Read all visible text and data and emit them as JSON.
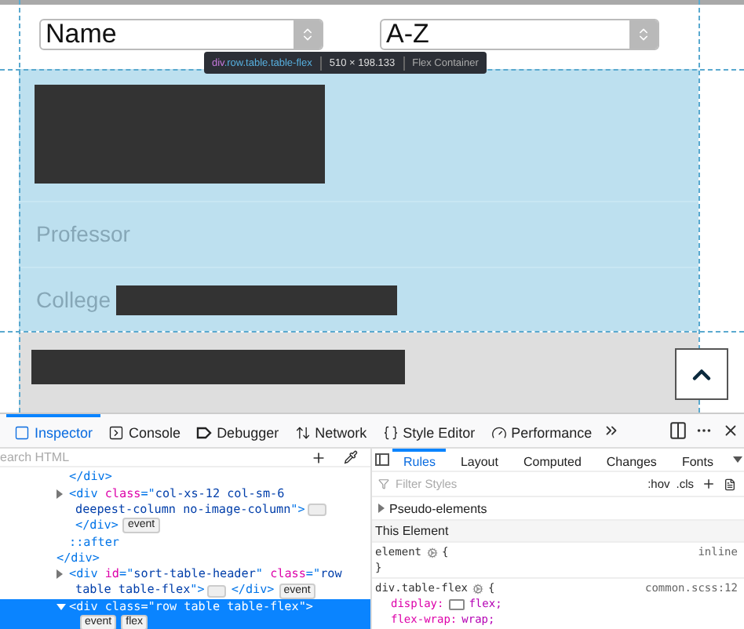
{
  "page": {
    "sort_selects": [
      {
        "value": "Name"
      },
      {
        "value": "A-Z"
      }
    ],
    "highlight_tooltip": {
      "tag": "div",
      "classes": ".row.table.table-flex",
      "size": "510 × 198.133",
      "kind_label": "Flex Container"
    },
    "card": {
      "role_label": "Professor",
      "college_label": "College"
    }
  },
  "devtools": {
    "tabs": [
      {
        "label": "Inspector",
        "selected": true
      },
      {
        "label": "Console",
        "selected": false
      },
      {
        "label": "Debugger",
        "selected": false
      },
      {
        "label": "Network",
        "selected": false
      },
      {
        "label": "Style Editor",
        "selected": false
      },
      {
        "label": "Performance",
        "selected": false
      }
    ],
    "search": {
      "placeholder": "earch HTML"
    },
    "markup": [
      {
        "selected": false,
        "children": [
          {
            "selected": false,
            "rows": [
              {
                "parts": [
                  {
                    "kind": "tag",
                    "text": "</div>"
                  }
                ]
              }
            ]
          },
          {
            "selected": false,
            "expanded": false,
            "rows": [
              {
                "parts": [
                  {
                    "kind": "tag",
                    "text": "<div "
                  },
                  {
                    "kind": "attr",
                    "text": "class"
                  },
                  {
                    "kind": "punct",
                    "text": "=\""
                  },
                  {
                    "kind": "value",
                    "text": "col-xs-12 col-sm-6"
                  }
                ]
              },
              {
                "parts": [
                  {
                    "kind": "value",
                    "text": "deepest-column no-image-column"
                  },
                  {
                    "kind": "punct",
                    "text": "\""
                  },
                  {
                    "kind": "tag",
                    "text": ">"
                  },
                  {
                    "kind": "dots"
                  }
                ]
              },
              {
                "parts": [
                  {
                    "kind": "tag",
                    "text": "</div>"
                  },
                  {
                    "kind": "badge",
                    "text": "event"
                  }
                ]
              }
            ]
          },
          {
            "selected": false,
            "rows": [
              {
                "parts": [
                  {
                    "kind": "tag",
                    "text": "::after"
                  }
                ]
              }
            ]
          }
        ],
        "closing_rows": [
          {
            "parts": [
              {
                "kind": "tag",
                "text": "</div>"
              }
            ]
          }
        ]
      },
      {
        "selected": false,
        "expanded": false,
        "rows": [
          {
            "parts": [
              {
                "kind": "tag",
                "text": "<div "
              },
              {
                "kind": "attr",
                "text": "id"
              },
              {
                "kind": "punct",
                "text": "=\""
              },
              {
                "kind": "value",
                "text": "sort-table-header"
              },
              {
                "kind": "punct",
                "text": "\" "
              },
              {
                "kind": "attr",
                "text": "class"
              },
              {
                "kind": "punct",
                "text": "=\""
              },
              {
                "kind": "value",
                "text": "row"
              }
            ]
          },
          {
            "parts": [
              {
                "kind": "value",
                "text": "table table-flex"
              },
              {
                "kind": "punct",
                "text": "\""
              },
              {
                "kind": "tag",
                "text": ">"
              },
              {
                "kind": "dots"
              },
              {
                "kind": "tag",
                "text": "</div>"
              },
              {
                "kind": "badge",
                "text": "event"
              }
            ]
          }
        ]
      },
      {
        "selected": true,
        "expanded": true,
        "rows": [
          {
            "parts": [
              {
                "kind": "tag",
                "text": "<div "
              },
              {
                "kind": "attr",
                "text": "class"
              },
              {
                "kind": "punct",
                "text": "=\""
              },
              {
                "kind": "value",
                "text": "row table table-flex"
              },
              {
                "kind": "punct",
                "text": "\""
              },
              {
                "kind": "tag",
                "text": ">"
              }
            ]
          },
          {
            "parts": [
              {
                "kind": "badge",
                "text": "event"
              },
              {
                "kind": "badge",
                "text": "flex"
              }
            ]
          }
        ]
      }
    ],
    "side_tabs": [
      {
        "label": "Rules",
        "selected": true
      },
      {
        "label": "Layout",
        "selected": false
      },
      {
        "label": "Computed",
        "selected": false
      },
      {
        "label": "Changes",
        "selected": false
      },
      {
        "label": "Fonts",
        "selected": false
      }
    ],
    "filter": {
      "placeholder": "Filter Styles",
      "hov": ":hov",
      "cls": ".cls"
    },
    "pseudo_elements": {
      "label": "Pseudo-elements",
      "expanded": false
    },
    "section_title": "This Element",
    "rules": [
      {
        "selector": "element",
        "open": "{",
        "source": "inline",
        "close": "}"
      },
      {
        "selector": "div.table-flex",
        "open": "{",
        "source": "common.scss:12",
        "declarations": [
          {
            "property": "display:",
            "value": "flex;",
            "grid_badge": true
          },
          {
            "property": "flex-wrap:",
            "value": "wrap;"
          }
        ]
      }
    ]
  }
}
